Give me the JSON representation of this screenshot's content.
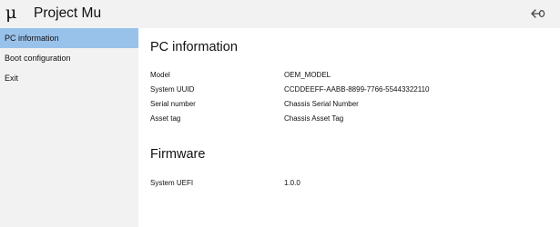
{
  "app": {
    "logo_glyph": "μ",
    "title": "Project Mu",
    "back_icon": "back-arrow-icon"
  },
  "sidebar": {
    "items": [
      {
        "label": "PC information",
        "selected": true
      },
      {
        "label": "Boot configuration",
        "selected": false
      },
      {
        "label": "Exit",
        "selected": false
      }
    ]
  },
  "main": {
    "pc_info": {
      "heading": "PC information",
      "rows": [
        {
          "label": "Model",
          "value": "OEM_MODEL"
        },
        {
          "label": "System UUID",
          "value": "CCDDEEFF-AABB-8899-7766-55443322110"
        },
        {
          "label": "Serial number",
          "value": "Chassis Serial Number"
        },
        {
          "label": "Asset tag",
          "value": "Chassis Asset Tag"
        }
      ]
    },
    "firmware": {
      "heading": "Firmware",
      "rows": [
        {
          "label": "System UEFI",
          "value": "1.0.0"
        }
      ]
    }
  },
  "colors": {
    "sidebar_bg": "#f2f2f2",
    "selected_bg": "#99c2ea",
    "content_bg": "#ffffff"
  }
}
